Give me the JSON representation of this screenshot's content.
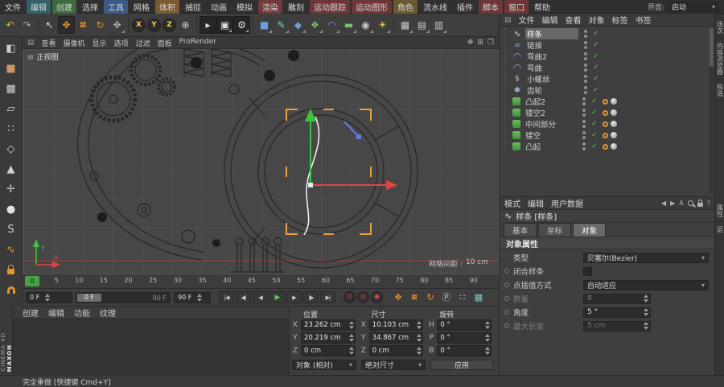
{
  "menubar": {
    "items": [
      {
        "label": "文件"
      },
      {
        "label": "编辑",
        "bg": "#34606a"
      },
      {
        "label": "创建",
        "bg": "#3d6b3d"
      },
      {
        "label": "选择"
      },
      {
        "label": "工具",
        "bg": "#3d5a86"
      },
      {
        "label": "网格"
      },
      {
        "label": "体积",
        "bg": "#7a5a30"
      },
      {
        "label": "捕捉"
      },
      {
        "label": "动画"
      },
      {
        "label": "模拟"
      },
      {
        "label": "渲染",
        "bg": "#743a3a"
      },
      {
        "label": "雕刻"
      },
      {
        "label": "运动跟踪",
        "bg": "#6e3636"
      },
      {
        "label": "运动图形",
        "bg": "#6e3636"
      },
      {
        "label": "角色",
        "bg": "#6a5a32"
      },
      {
        "label": "流水线"
      },
      {
        "label": "插件"
      },
      {
        "label": "脚本",
        "bg": "#6e3636"
      },
      {
        "label": "窗口",
        "bg": "#6e3636"
      },
      {
        "label": "帮助"
      }
    ],
    "interface_label": "界面:",
    "interface_value": "启动"
  },
  "toolbar": {
    "items": [
      {
        "n": "undo-icon",
        "g": "↶",
        "c": "#d8b84a"
      },
      {
        "n": "redo-icon",
        "g": "↷",
        "c": "#a8a8a8"
      },
      {
        "sep": true
      },
      {
        "n": "live-selection-icon",
        "g": "↖",
        "c": "#e0e0e0"
      },
      {
        "n": "move-tool-icon",
        "g": "✥",
        "c": "#e8932c",
        "active": true
      },
      {
        "n": "scale-tool-icon",
        "g": "✥",
        "c": "#e8932c",
        "rot": true
      },
      {
        "n": "rotate-tool-icon",
        "g": "↻",
        "c": "#e8932c"
      },
      {
        "n": "recent-tool-icon",
        "g": "✥",
        "c": "#b0b0b0",
        "flyout": true
      },
      {
        "sep": true
      },
      {
        "n": "x-axis-lock-icon",
        "g": "X",
        "c": "#e8d44a",
        "circle": true
      },
      {
        "n": "y-axis-lock-icon",
        "g": "Y",
        "c": "#e8d44a",
        "circle": true
      },
      {
        "n": "z-axis-lock-icon",
        "g": "Z",
        "c": "#e8d44a",
        "circle": true
      },
      {
        "n": "coord-system-icon",
        "g": "⊕",
        "c": "#d0d0d0"
      },
      {
        "sep": true
      },
      {
        "n": "render-view-icon",
        "g": "▸",
        "c": "#e0e0e0",
        "dark": true
      },
      {
        "n": "render-picture-viewer-icon",
        "g": "▣",
        "c": "#e0e0e0",
        "dark": true,
        "flyout": true
      },
      {
        "n": "render-settings-icon",
        "g": "⚙",
        "c": "#e0e0e0",
        "dark": true,
        "flyout": true
      },
      {
        "sep": true
      },
      {
        "n": "cube-primitive-icon",
        "g": "■",
        "c": "#6a9fd8",
        "flyout": true
      },
      {
        "n": "pen-spline-icon",
        "g": "✎",
        "c": "#7ec8c8",
        "flyout": true
      },
      {
        "n": "subdivision-surface-icon",
        "g": "◆",
        "c": "#6a9fd8",
        "flyout": true
      },
      {
        "n": "array-generator-icon",
        "g": "❖",
        "c": "#7bbf6a",
        "flyout": true
      },
      {
        "n": "bend-deformer-icon",
        "g": "◠",
        "c": "#b48ad6",
        "flyout": true
      },
      {
        "n": "floor-environment-icon",
        "g": "▬",
        "c": "#7bbf6a",
        "flyout": true
      },
      {
        "n": "camera-icon",
        "g": "◉",
        "c": "#c8c8c8",
        "flyout": true
      },
      {
        "n": "light-icon",
        "g": "☀",
        "c": "#e8d44a",
        "flyout": true
      },
      {
        "sep": true
      },
      {
        "n": "snap-toggle-icon",
        "g": "▦",
        "c": "#c8c8c8",
        "flyout": true
      },
      {
        "n": "grid-quantize-icon",
        "g": "▤",
        "c": "#c8c8c8",
        "flyout": true
      },
      {
        "n": "workplane-snap-icon",
        "g": "▥",
        "c": "#c8c8c8",
        "flyout": true
      }
    ]
  },
  "left_toolbar": {
    "items": [
      {
        "n": "convert-editable-icon",
        "g": "◧",
        "c": "#cfcfcf"
      },
      {
        "n": "model-mode-icon",
        "g": "■",
        "c": "#c89a6a"
      },
      {
        "n": "texture-mode-icon",
        "g": "▩",
        "c": "#cfcfcf"
      },
      {
        "n": "workplane-mode-icon",
        "g": "▱",
        "c": "#cfcfcf"
      },
      {
        "n": "points-mode-icon",
        "g": "∷",
        "c": "#cfcfcf"
      },
      {
        "n": "edges-mode-icon",
        "g": "◇",
        "c": "#cfcfcf"
      },
      {
        "n": "polygons-mode-icon",
        "g": "▲",
        "c": "#cfcfcf"
      },
      {
        "n": "enable-axis-icon",
        "g": "✛",
        "c": "#cfcfcf"
      },
      {
        "n": "viewport-solo-icon",
        "g": "●",
        "c": "#e0e0e0"
      },
      {
        "n": "simulation-icon",
        "g": "S",
        "c": "#cfcfcf"
      },
      {
        "n": "paint-tool-icon",
        "g": "∿",
        "c": "#e8932c"
      },
      {
        "n": "lock-icon",
        "is_lock": true
      },
      {
        "n": "snap-magnet-icon",
        "is_magnet": true
      }
    ]
  },
  "viewport": {
    "menu": [
      "查看",
      "摄像机",
      "显示",
      "选项",
      "过滤",
      "面板",
      "ProRender"
    ],
    "view_label": "正视图",
    "grid_label": "网格间距 :",
    "grid_value": "10 cm",
    "axis_x": "X",
    "axis_y": "Y",
    "right_icons": [
      {
        "n": "pan-view-icon",
        "g": "✥"
      },
      {
        "n": "split-views-icon",
        "g": "⊞"
      },
      {
        "n": "maximize-view-icon",
        "g": "❐"
      }
    ]
  },
  "timeline": {
    "ticks": [
      "0",
      "5",
      "10",
      "15",
      "20",
      "25",
      "30",
      "35",
      "40",
      "45",
      "50",
      "55",
      "60",
      "65",
      "70",
      "75",
      "80",
      "85",
      "90"
    ],
    "marker": "0"
  },
  "anim": {
    "start_value": "0 F",
    "slider_handle": "0 F",
    "slider_end": "90 F",
    "end_value": "90 F",
    "transport": [
      {
        "n": "goto-start-button",
        "g": "|◀"
      },
      {
        "n": "prev-key-button",
        "g": "◀|"
      },
      {
        "n": "prev-frame-button",
        "g": "◀"
      },
      {
        "n": "play-button",
        "g": "▶",
        "green": true
      },
      {
        "n": "next-frame-button",
        "g": "▶"
      },
      {
        "n": "next-key-button",
        "g": "|▶"
      },
      {
        "n": "goto-end-button",
        "g": "▶|"
      }
    ],
    "record": [
      {
        "n": "record-keyframe-button",
        "g": "⊙"
      },
      {
        "n": "autokey-button",
        "g": "◎"
      },
      {
        "n": "record-options-button",
        "g": "◉"
      }
    ],
    "keys": [
      {
        "n": "key-position-icon",
        "g": "✥",
        "c": "#e8932c"
      },
      {
        "n": "key-scale-icon",
        "g": "✥",
        "c": "#e8932c",
        "rot": true
      },
      {
        "n": "key-rotation-icon",
        "g": "↻",
        "c": "#e8932c"
      },
      {
        "n": "key-parameter-icon",
        "g": "Ⓟ",
        "c": "#cccccc"
      },
      {
        "n": "key-pla-icon",
        "g": "∷",
        "c": "#cccccc"
      },
      {
        "n": "keyframe-presets-icon",
        "g": "▦",
        "c": "#7ec8c8"
      }
    ]
  },
  "materials_panel": {
    "tabs": [
      "创建",
      "编辑",
      "功能",
      "纹理"
    ]
  },
  "coords_panel": {
    "pos_title": "位置",
    "size_title": "尺寸",
    "rot_title": "旋转",
    "pos_rows": [
      {
        "axis": "X",
        "value": "23.262 cm"
      },
      {
        "axis": "Y",
        "value": "20.219 cm"
      },
      {
        "axis": "Z",
        "value": "0 cm"
      }
    ],
    "size_rows": [
      {
        "axis": "X",
        "value": "10.103 cm"
      },
      {
        "axis": "Y",
        "value": "34.867 cm"
      },
      {
        "axis": "Z",
        "value": "0 cm"
      }
    ],
    "rot_rows": [
      {
        "axis": "H",
        "value": "0 °"
      },
      {
        "axis": "P",
        "value": "0 °"
      },
      {
        "axis": "B",
        "value": "0 °"
      }
    ],
    "mode_dropdown": "对象 (相对)",
    "size_dropdown": "绝对尺寸",
    "apply_button": "应用"
  },
  "object_manager": {
    "menu": [
      "文件",
      "编辑",
      "查看",
      "对象",
      "标签",
      "书签"
    ],
    "objects": [
      {
        "name": "样条",
        "kind": "spline",
        "selected": true
      },
      {
        "name": "链接",
        "kind": "link"
      },
      {
        "name": "弯曲2",
        "kind": "bend"
      },
      {
        "name": "弯曲",
        "kind": "bend"
      },
      {
        "name": "小螺丝",
        "kind": "screw"
      },
      {
        "name": "齿轮",
        "kind": "gear"
      },
      {
        "name": "凸起2",
        "kind": "extrude",
        "tags": true
      },
      {
        "name": "镂空2",
        "kind": "extrude",
        "tags": true
      },
      {
        "name": "中间部分",
        "kind": "extrude",
        "tags": true
      },
      {
        "name": "镂空",
        "kind": "extrude",
        "tags": true
      },
      {
        "name": "凸起",
        "kind": "extrude",
        "tags": true
      }
    ]
  },
  "attributes": {
    "menu": [
      "模式",
      "编辑",
      "用户数据"
    ],
    "back_icon": "◀",
    "fwd_icon": "▶",
    "a_icon": "A",
    "help_icon": "?",
    "title_icon": "∿",
    "title": "样条 [样条]",
    "subtabs": [
      {
        "label": "基本"
      },
      {
        "label": "坐标"
      },
      {
        "label": "对象",
        "active": true
      }
    ],
    "section": "对象属性",
    "rows": [
      {
        "label": "类型",
        "value": "贝塞尔(Bezier)",
        "is_dropdown": true
      },
      {
        "label": "闭合样条",
        "is_checkbox": true,
        "dot": true
      },
      {
        "label": "点插值方式",
        "value": "自动适应",
        "is_dropdown": true,
        "dot": true
      },
      {
        "label": "数量",
        "value": "8",
        "is_number": true,
        "disabled": true,
        "dot": true
      },
      {
        "label": "角度",
        "value": "5 °",
        "is_number": true,
        "dot": true
      },
      {
        "label": "最大长度",
        "value": "5 cm",
        "is_number": true,
        "disabled": true,
        "dot": true
      }
    ]
  },
  "right_dock": {
    "top_tabs": [
      "场次",
      "内容浏览器",
      "构造"
    ],
    "bottom_tabs": [
      "属性",
      "层"
    ]
  },
  "logo": {
    "maxon": "MAXON",
    "cinema": "CINEMA 4D"
  },
  "statusbar": {
    "text": "完全重做 [快捷键 Cmd+Y]"
  }
}
